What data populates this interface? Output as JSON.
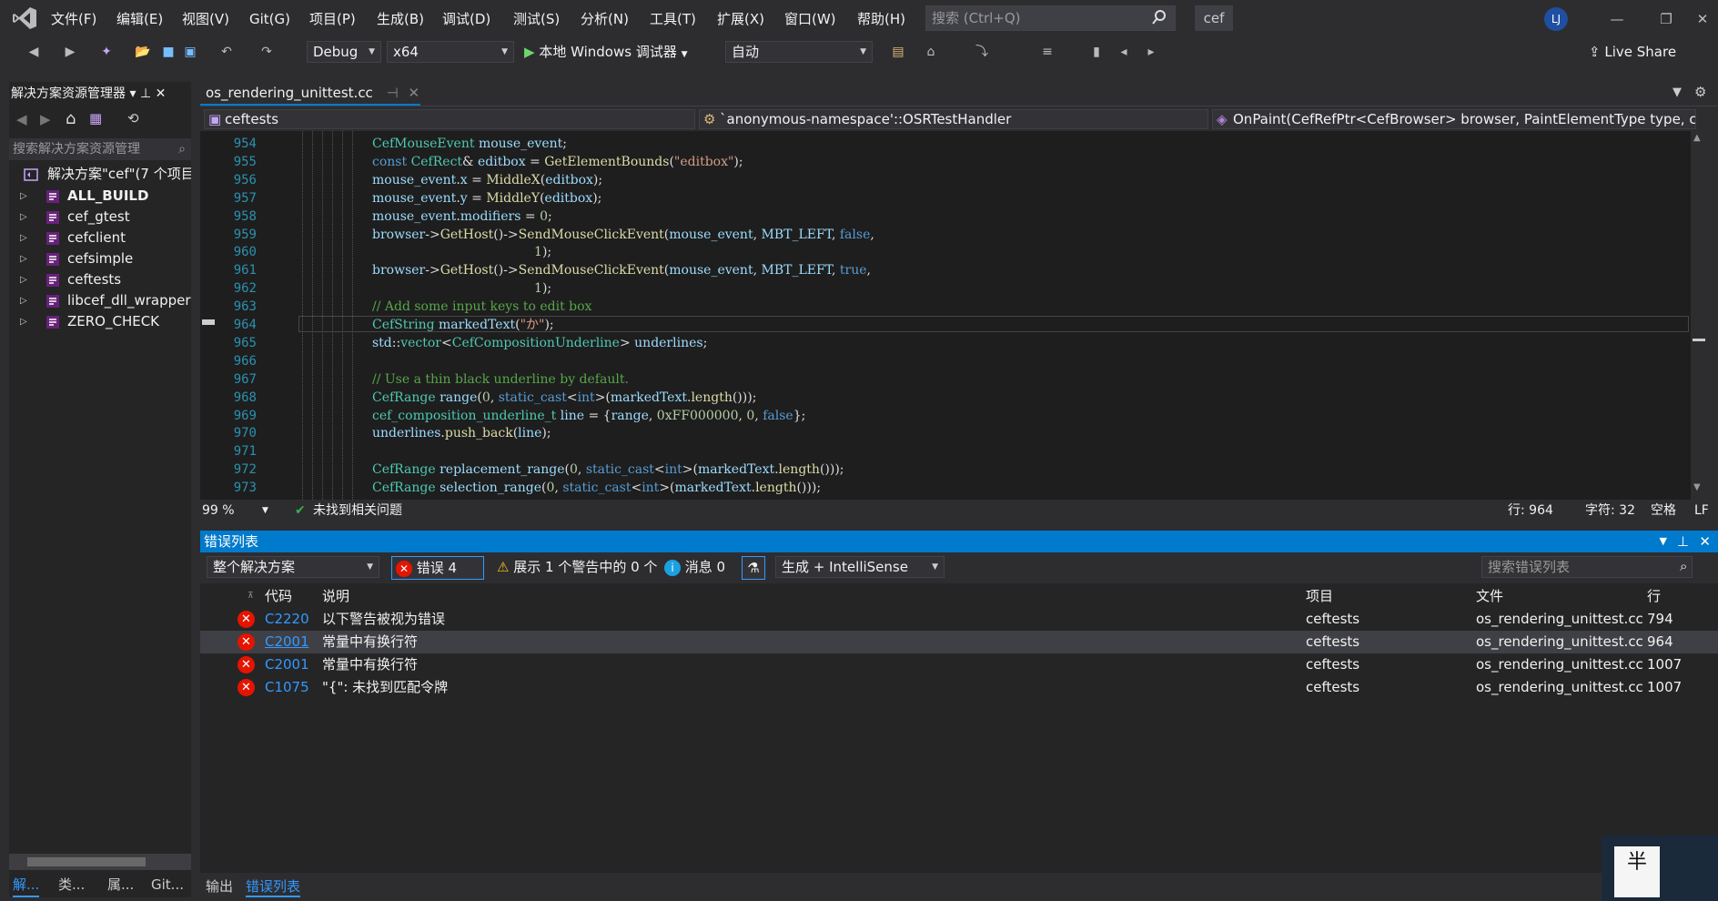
{
  "menu": [
    "文件(F)",
    "编辑(E)",
    "视图(V)",
    "Git(G)",
    "项目(P)",
    "生成(B)",
    "调试(D)",
    "测试(S)",
    "分析(N)",
    "工具(T)",
    "扩展(X)",
    "窗口(W)",
    "帮助(H)"
  ],
  "search_placeholder": "搜索 (Ctrl+Q)",
  "solution_short": "cef",
  "avatar": "LJ",
  "toolbar": {
    "config": "Debug",
    "platform": "x64",
    "debugger": "本地 Windows 调试器",
    "auto": "自动",
    "live_share": "Live Share"
  },
  "solution_explorer": {
    "title": "解决方案资源管理器",
    "search": "搜索解决方案资源管理",
    "root": "解决方案\"cef\"(7 个项目",
    "items": [
      "ALL_BUILD",
      "cef_gtest",
      "cefclient",
      "cefsimple",
      "ceftests",
      "libcef_dll_wrapper",
      "ZERO_CHECK"
    ]
  },
  "left_tabs": [
    "解...",
    "类...",
    "属...",
    "Git..."
  ],
  "editor": {
    "tab": "os_rendering_unittest.cc",
    "nav1": "ceftests",
    "nav2": "`anonymous-namespace'::OSRTestHandler",
    "nav3": "OnPaint(CefRefPtr<CefBrowser> browser, PaintElementType type, cc"
  },
  "lines": [
    "954",
    "955",
    "956",
    "957",
    "958",
    "959",
    "960",
    "961",
    "962",
    "963",
    "964",
    "965",
    "966",
    "967",
    "968",
    "969",
    "970",
    "971",
    "972",
    "973"
  ],
  "status": {
    "zoom": "99 %",
    "issues": "未找到相关问题",
    "line": "行: 964",
    "char": "字符: 32",
    "space": "空格",
    "eol": "LF"
  },
  "errors": {
    "title": "错误列表",
    "scope": "整个解决方案",
    "err_count": "错误 4",
    "warn": "展示 1 个警告中的 0 个",
    "msg": "消息 0",
    "build": "生成 + IntelliSense",
    "search": "搜索错误列表",
    "cols": {
      "code": "代码",
      "desc": "说明",
      "project": "项目",
      "file": "文件",
      "line": "行"
    },
    "rows": [
      {
        "code": "C2220",
        "desc": "以下警告被视为错误",
        "project": "ceftests",
        "file": "os_rendering_unittest.cc",
        "line": "794"
      },
      {
        "code": "C2001",
        "desc": "常量中有换行符",
        "project": "ceftests",
        "file": "os_rendering_unittest.cc",
        "line": "964"
      },
      {
        "code": "C2001",
        "desc": "常量中有换行符",
        "project": "ceftests",
        "file": "os_rendering_unittest.cc",
        "line": "1007"
      },
      {
        "code": "C1075",
        "desc": "\"{\": 未找到匹配令牌",
        "project": "ceftests",
        "file": "os_rendering_unittest.cc",
        "line": "1007"
      }
    ]
  },
  "bottom_tabs": [
    "输出",
    "错误列表"
  ],
  "ime": "半"
}
